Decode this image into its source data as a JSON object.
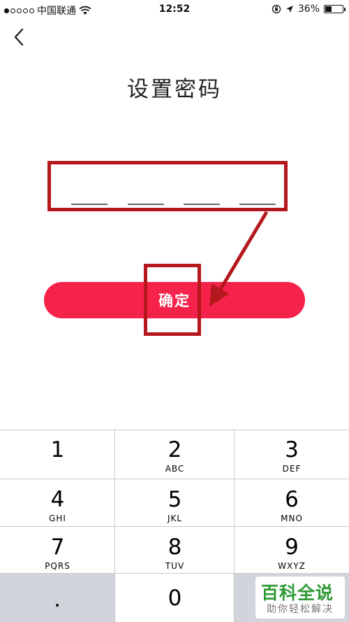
{
  "status_bar": {
    "carrier": "中国联通",
    "time": "12:52",
    "battery": "36%",
    "signal_dots_filled": 1,
    "signal_dots_total": 5
  },
  "page": {
    "title": "设置密码",
    "confirm_label": "确定",
    "password_slots": 4
  },
  "keypad": {
    "keys": [
      {
        "num": "1",
        "letters": ""
      },
      {
        "num": "2",
        "letters": "ABC"
      },
      {
        "num": "3",
        "letters": "DEF"
      },
      {
        "num": "4",
        "letters": "GHI"
      },
      {
        "num": "5",
        "letters": "JKL"
      },
      {
        "num": "6",
        "letters": "MNO"
      },
      {
        "num": "7",
        "letters": "PQRS"
      },
      {
        "num": "8",
        "letters": "TUV"
      },
      {
        "num": "9",
        "letters": "WXYZ"
      },
      {
        "num": ".",
        "letters": ""
      },
      {
        "num": "0",
        "letters": ""
      }
    ]
  },
  "watermark": {
    "title": "百科全说",
    "subtitle": "助你轻松解决"
  },
  "colors": {
    "button": "#f5224b",
    "annotation": "#b4181c",
    "keypad_gray": "#d1d4db"
  }
}
